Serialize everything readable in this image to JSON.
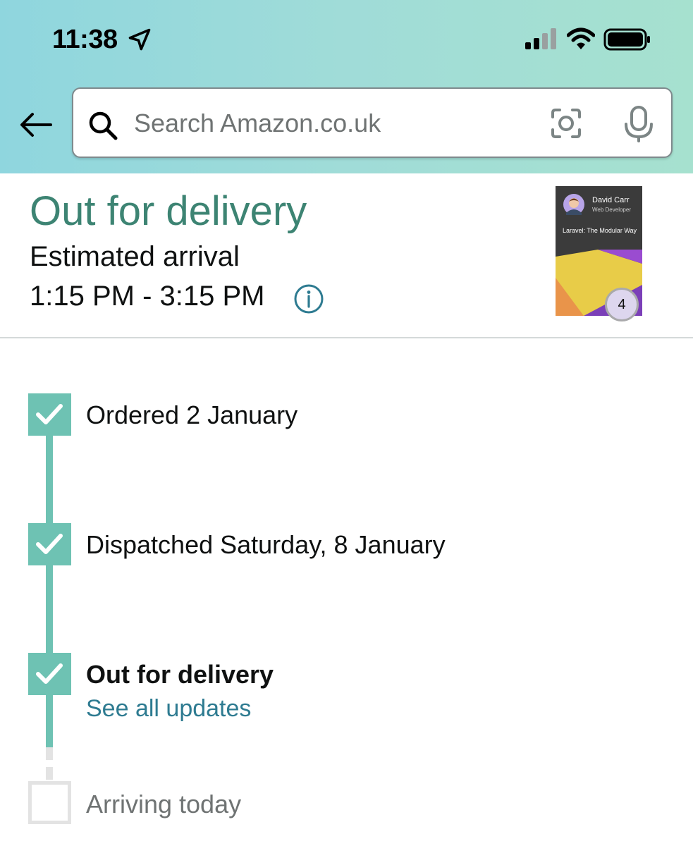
{
  "status_bar": {
    "time": "11:38",
    "icons": [
      "location-arrow-icon",
      "signal-icon",
      "wifi-icon",
      "battery-icon"
    ]
  },
  "header": {
    "back_icon": "back-arrow-icon",
    "search": {
      "placeholder": "Search Amazon.co.uk",
      "value": "",
      "icons": [
        "search-icon",
        "camera-scan-icon",
        "microphone-icon"
      ]
    }
  },
  "delivery": {
    "title": "Out for delivery",
    "estimated_label": "Estimated arrival",
    "estimated_window": "1:15 PM - 3:15 PM",
    "info_icon": "info-icon"
  },
  "product": {
    "author": "David Carr",
    "author_role": "Web Developer",
    "book_title": "Laravel: The Modular Way",
    "quantity": "4"
  },
  "timeline": {
    "steps": [
      {
        "label": "Ordered 2 January",
        "status": "done"
      },
      {
        "label": "Dispatched Saturday, 8 January",
        "status": "done"
      },
      {
        "label": "Out for delivery",
        "status": "current"
      },
      {
        "label": "Arriving today",
        "status": "pending"
      }
    ],
    "see_all_link": "See all updates"
  },
  "colors": {
    "header_gradient_start": "#8fd6de",
    "header_gradient_end": "#a6e1cf",
    "accent_teal": "#3d8473",
    "step_done": "#6ec2b3",
    "step_pending": "#e3e3e3",
    "link": "#2e7b91"
  }
}
